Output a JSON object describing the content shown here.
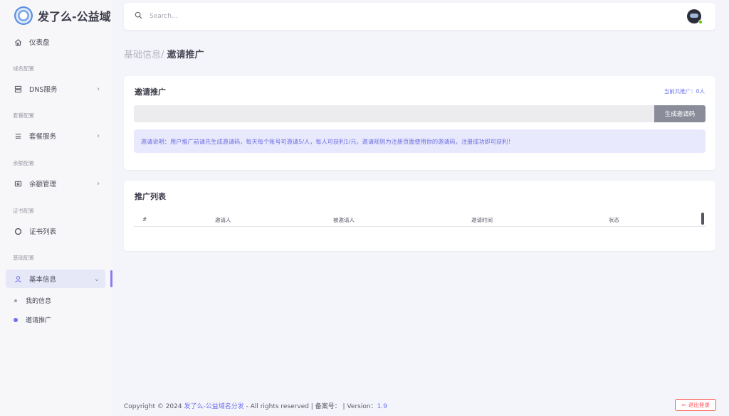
{
  "brand": {
    "title": "发了么-公益域"
  },
  "sidebar": {
    "dashboard": {
      "label": "仪表盘"
    },
    "sections": [
      {
        "label": "域名配置",
        "item": "DNS服务"
      },
      {
        "label": "套餐配置",
        "item": "套餐服务"
      },
      {
        "label": "余额配置",
        "item": "余额管理"
      },
      {
        "label": "证书配置",
        "item": "证书列表"
      },
      {
        "label": "基础配置",
        "item": "基本信息"
      }
    ],
    "sub_items": [
      "我的信息",
      "邀请推广"
    ]
  },
  "search": {
    "placeholder": "Search..."
  },
  "breadcrumb": {
    "parent": "基础信息/",
    "current": "邀请推广"
  },
  "invite_card": {
    "title": "邀请推广",
    "count_text": "当前共推广：0人",
    "generate_button": "生成邀请码",
    "notice": "邀请说明：用户推广前请先生成邀请码，每天每个账号可邀请5/人，每人可获利1/元，邀请规则为注册页面使用你的邀请码，注册成功即可获利！"
  },
  "list_card": {
    "title": "推广列表",
    "columns": [
      "#",
      "邀请人",
      "被邀请人",
      "邀请时间",
      "状态"
    ]
  },
  "footer": {
    "prefix": "Copyright © 2024 ",
    "site": "发了么-公益域名分发",
    "suffix": " - All rights reserved | 备案号： | Version：",
    "version": "1.9",
    "logout": "退出登录"
  },
  "colors": {
    "accent": "#6c6ff0",
    "danger": "#ff4c51",
    "online": "#56ca00"
  }
}
